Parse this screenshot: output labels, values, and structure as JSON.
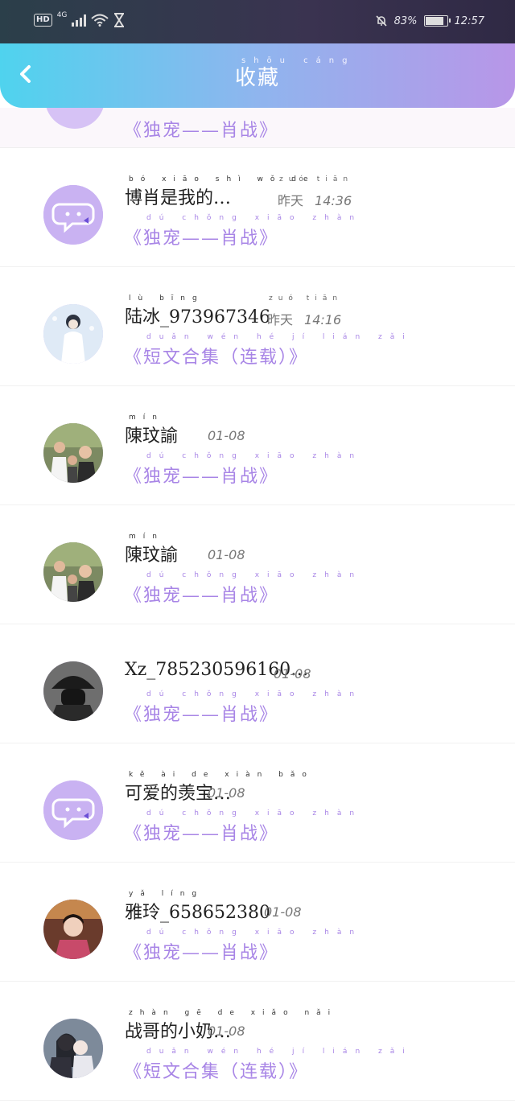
{
  "status_bar": {
    "hd": "HD",
    "network": "4G",
    "battery": "83%",
    "time": "12:57"
  },
  "header": {
    "title": "收藏",
    "title_pinyin": "shōu cáng",
    "back_icon": "chevron-left-icon"
  },
  "partial_item": {
    "subtitle": "《独宠——肖战》"
  },
  "items": [
    {
      "name": "博肖是我的…",
      "name_pinyin": "bó xiāo shì wǒ de",
      "time": "14:36",
      "time_prefix": "昨天",
      "time_pinyin": "zuó tiān",
      "subtitle": "《独宠——肖战》",
      "subtitle_pinyin": "dú chǒng xiāo zhàn",
      "avatar": "default-chat-avatar"
    },
    {
      "name": "陆冰_973967346",
      "name_pinyin": "lù bīng",
      "time": "14:16",
      "time_prefix": "昨天",
      "time_pinyin": "zuó tiān",
      "subtitle": "《短文合集（连载）》",
      "subtitle_pinyin": "duǎn wén hé jí lián zǎi",
      "avatar": "photo-avatar-light"
    },
    {
      "name": "陳玟諭",
      "name_pinyin": "mín",
      "time": "01-08",
      "time_prefix": "",
      "time_pinyin": "",
      "subtitle": "《独宠——肖战》",
      "subtitle_pinyin": "dú chǒng xiāo zhàn",
      "avatar": "photo-avatar-group"
    },
    {
      "name": "陳玟諭",
      "name_pinyin": "mín",
      "time": "01-08",
      "time_prefix": "",
      "time_pinyin": "",
      "subtitle": "《独宠——肖战》",
      "subtitle_pinyin": "dú chǒng xiāo zhàn",
      "avatar": "photo-avatar-group"
    },
    {
      "name": "Xz_785230596160…",
      "name_pinyin": "",
      "time": "01-08",
      "time_prefix": "",
      "time_pinyin": "",
      "subtitle": "《独宠——肖战》",
      "subtitle_pinyin": "dú chǒng xiāo zhàn",
      "avatar": "photo-avatar-dark"
    },
    {
      "name": "可爱的羡宝…",
      "name_pinyin": "kě ài de xiàn bǎo",
      "time": "01-08",
      "time_prefix": "",
      "time_pinyin": "",
      "subtitle": "《独宠——肖战》",
      "subtitle_pinyin": "dú chǒng xiāo zhàn",
      "avatar": "default-chat-avatar"
    },
    {
      "name": "雅玲_658652380",
      "name_pinyin": "yǎ líng",
      "time": "01-08",
      "time_prefix": "",
      "time_pinyin": "",
      "subtitle": "《独宠——肖战》",
      "subtitle_pinyin": "dú chǒng xiāo zhàn",
      "avatar": "photo-avatar-portrait"
    },
    {
      "name": "战哥的小奶…",
      "name_pinyin": "zhàn gē de xiǎo nǎi",
      "time": "01-08",
      "time_prefix": "",
      "time_pinyin": "",
      "subtitle": "《短文合集（连载）》",
      "subtitle_pinyin": "duǎn wén hé jí lián zǎi",
      "avatar": "photo-avatar-couple"
    }
  ]
}
